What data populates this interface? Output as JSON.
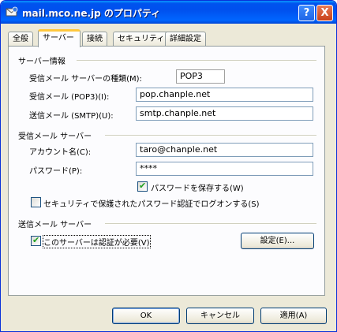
{
  "window": {
    "title": "mail.mco.ne.jp のプロパティ",
    "help_label": "?",
    "close_label": "X"
  },
  "tabs": [
    {
      "label": "全般"
    },
    {
      "label": "サーバー"
    },
    {
      "label": "接続"
    },
    {
      "label": "セキュリティ"
    },
    {
      "label": "詳細設定"
    }
  ],
  "server_info": {
    "section_title": "サーバー情報",
    "incoming_type_label": "受信メール サーバーの種類(M):",
    "incoming_type_value": "POP3",
    "incoming_label": "受信メール (POP3)(I):",
    "incoming_value": "pop.chanple.net",
    "outgoing_label": "送信メール (SMTP)(U):",
    "outgoing_value": "smtp.chanple.net"
  },
  "incoming_server": {
    "section_title": "受信メール サーバー",
    "account_label": "アカウント名(C):",
    "account_value": "taro@chanple.net",
    "password_label": "パスワード(P):",
    "password_value": "****",
    "remember_label": "パスワードを保存する(W)",
    "remember_checked": true,
    "spa_label": "セキュリティで保護されたパスワード認証でログオンする(S)",
    "spa_checked": false
  },
  "outgoing_server": {
    "section_title": "送信メール サーバー",
    "auth_label": "このサーバーは認証が必要(V)",
    "auth_checked": true,
    "settings_label": "設定(E)..."
  },
  "footer": {
    "ok_label": "OK",
    "cancel_label": "キャンセル",
    "apply_label": "適用(A)"
  }
}
